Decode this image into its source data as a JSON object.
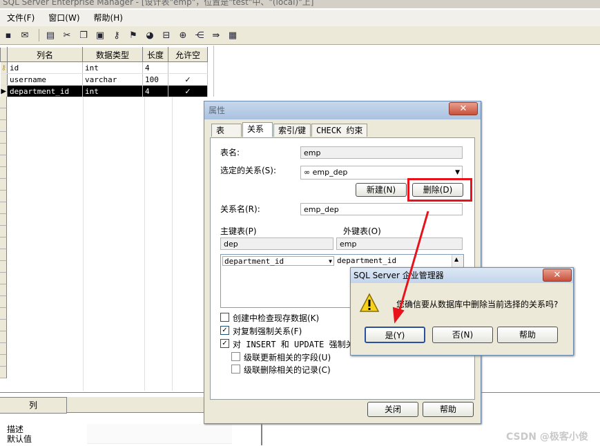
{
  "window": {
    "title": "SQL Server Enterprise Manager - [设计表\"emp\"，位置是\"test\"中、\"(local)\"上]"
  },
  "menu": [
    {
      "label": "文件(F)"
    },
    {
      "label": "窗口(W)"
    },
    {
      "label": "帮助(H)"
    }
  ],
  "toolbar": {
    "icons": [
      "save-icon",
      "properties-icon",
      "generate-script-icon",
      "cut-icon",
      "copy-icon",
      "paste-icon",
      "primary-key-icon",
      "manage-relationships-icon",
      "manage-indexes-icon",
      "manage-constraints-icon",
      "insert-column-icon",
      "delete-column-icon",
      "manage-triggers-icon",
      "table-grid-icon"
    ]
  },
  "grid": {
    "headers": [
      "列名",
      "数据类型",
      "长度",
      "允许空"
    ],
    "rows": [
      {
        "name": "id",
        "type": "int",
        "length": "4",
        "nullable": "",
        "pk": true
      },
      {
        "name": "username",
        "type": "varchar",
        "length": "100",
        "nullable": "✓"
      },
      {
        "name": "department_id",
        "type": "int",
        "length": "4",
        "nullable": "✓",
        "selected": true
      }
    ]
  },
  "bottom": {
    "tab": "列",
    "props": [
      {
        "label": "描述"
      },
      {
        "label": "默认值"
      }
    ]
  },
  "props_dialog": {
    "title": "属性",
    "tabs": [
      "表",
      "关系",
      "索引/键",
      "CHECK 约束"
    ],
    "table_name_label": "表名:",
    "table_name_value": "emp",
    "selected_rel_label": "选定的关系(S):",
    "selected_rel_value": "∞ emp_dep",
    "new_button": "新建(N)",
    "delete_button": "删除(D)",
    "rel_name_label": "关系名(R):",
    "rel_name_value": "emp_dep",
    "pk_table_label": "主键表(P)",
    "pk_table_value": "dep",
    "fk_table_label": "外键表(O)",
    "fk_table_value": "emp",
    "pk_column": "department_id",
    "fk_column": "department_id",
    "options": [
      {
        "label": "创建中检查现存数据(K)",
        "checked": false
      },
      {
        "label": "对复制强制关系(F)",
        "checked": true
      },
      {
        "label": "对 INSERT 和 UPDATE 强制关系",
        "checked": true
      },
      {
        "label": "级联更新相关的字段(U)",
        "checked": false
      },
      {
        "label": "级联删除相关的记录(C)",
        "checked": false
      }
    ],
    "close_button": "关闭",
    "help_button": "帮助"
  },
  "msgbox": {
    "title": "SQL Server 企业管理器",
    "message": "您确信要从数据库中删除当前选择的关系吗?",
    "yes_button": "是(Y)",
    "no_button": "否(N)",
    "help_button": "帮助"
  },
  "watermark": "CSDN @极客小俊",
  "colors": {
    "highlight": "#e8121b",
    "selection": "#000000"
  }
}
